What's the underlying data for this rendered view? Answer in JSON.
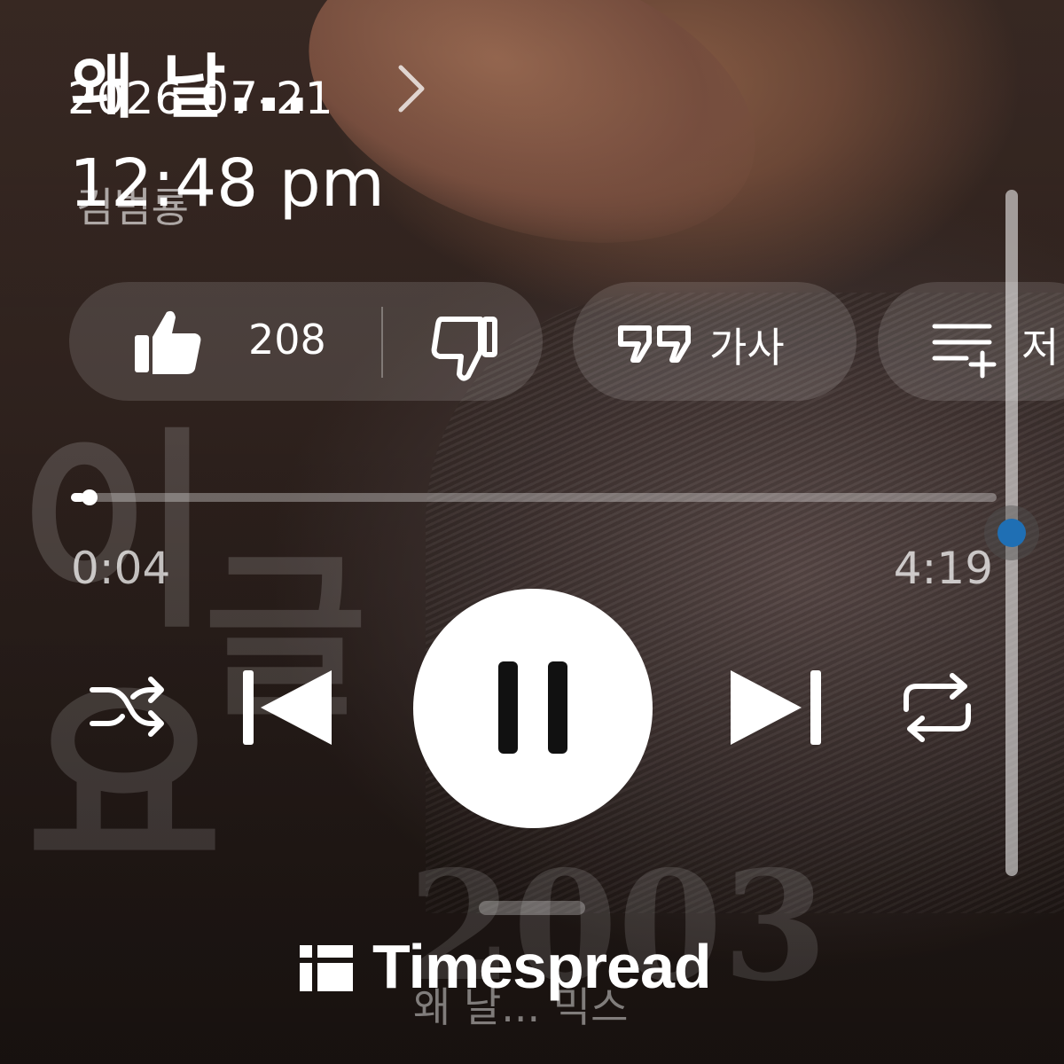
{
  "player": {
    "song_title": "왜 날...",
    "artist": "김범룡",
    "timestamp": {
      "date": "2026-07-21",
      "time": "12:48 pm"
    },
    "actions": {
      "like_count": "208",
      "lyrics_label": "가사",
      "save_label": "저"
    },
    "progress": {
      "elapsed": "0:04",
      "total": "4:19",
      "fraction": 0.015
    },
    "next_hint": "왜 날... 믹스",
    "icons": [
      "chevron-right-icon",
      "thumbs-up-icon",
      "thumbs-down-icon",
      "quote-icon",
      "queue-add-icon",
      "shuffle-icon",
      "previous-icon",
      "pause-icon",
      "next-icon",
      "repeat-icon"
    ]
  },
  "watermark": {
    "text": "Timespread"
  },
  "colors": {
    "scroll_accent": "#1f6fb4",
    "play_button": "#ffffff"
  }
}
